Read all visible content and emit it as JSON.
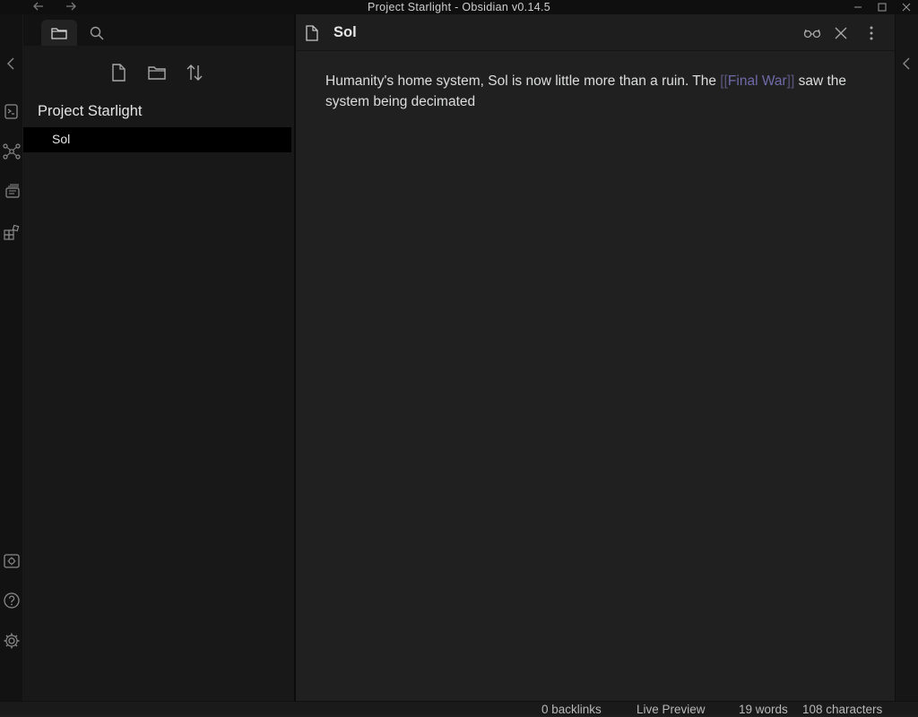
{
  "window": {
    "title": "Project Starlight - Obsidian v0.14.5",
    "back_icon": "arrow-left-icon",
    "forward_icon": "arrow-right-icon"
  },
  "ribbon": {
    "icons": [
      "collapse-left-icon",
      "command-palette-icon",
      "graph-view-icon",
      "slides-icon",
      "templates-icon",
      "vault-icon",
      "help-icon",
      "settings-icon"
    ]
  },
  "sidebar": {
    "tabs": [
      "file-explorer-tab",
      "search-tab"
    ],
    "actions": [
      "new-note-icon",
      "new-folder-icon",
      "sort-icon"
    ],
    "vault_name": "Project Starlight",
    "files": [
      {
        "name": "Sol",
        "active": true
      }
    ]
  },
  "editor": {
    "note_title": "Sol",
    "content": {
      "before": "Humanity's home system, Sol is now little more than a ruin. The ",
      "open_brackets": "[[",
      "link": "Final War",
      "close_brackets": "]]",
      "after": " saw the system being decimated"
    }
  },
  "statusbar": {
    "backlinks": "0 backlinks",
    "mode": "Live Preview",
    "words": "19 words",
    "characters": "108 characters"
  },
  "colors": {
    "background": "#1e1e1e",
    "sidebar": "#181818",
    "wikilink": "#6f6aa8",
    "text": "#dcddde"
  }
}
